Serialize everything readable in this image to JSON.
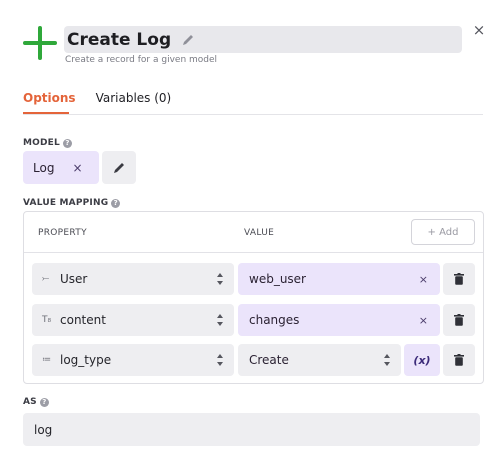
{
  "header": {
    "title": "Create Log",
    "subtitle": "Create a record for a given model",
    "close_glyph": "×",
    "accent_color": "#2fa83a"
  },
  "tabs": [
    {
      "label": "Options",
      "active": true
    },
    {
      "label": "Variables (0)",
      "active": false
    }
  ],
  "model": {
    "label": "MODEL",
    "value": "Log",
    "remove_glyph": "×"
  },
  "value_mapping": {
    "label": "VALUE MAPPING",
    "columns": {
      "property": "PROPERTY",
      "value": "VALUE"
    },
    "add_label": "+ Add",
    "rows": [
      {
        "type_icon": "⤚",
        "property": "User",
        "value": "web_user",
        "value_kind": "variable",
        "remove_glyph": "×"
      },
      {
        "type_icon": "T₈",
        "property": "content",
        "value": "changes",
        "value_kind": "variable",
        "remove_glyph": "×"
      },
      {
        "type_icon": "≔",
        "property": "log_type",
        "value": "Create",
        "value_kind": "select",
        "fx_label": "(x)"
      }
    ]
  },
  "as_field": {
    "label": "AS",
    "value": "log"
  },
  "colors": {
    "tab_active": "#e4643a",
    "variable_chip": "#ebe4fb",
    "field_bg": "#eeeef1"
  }
}
